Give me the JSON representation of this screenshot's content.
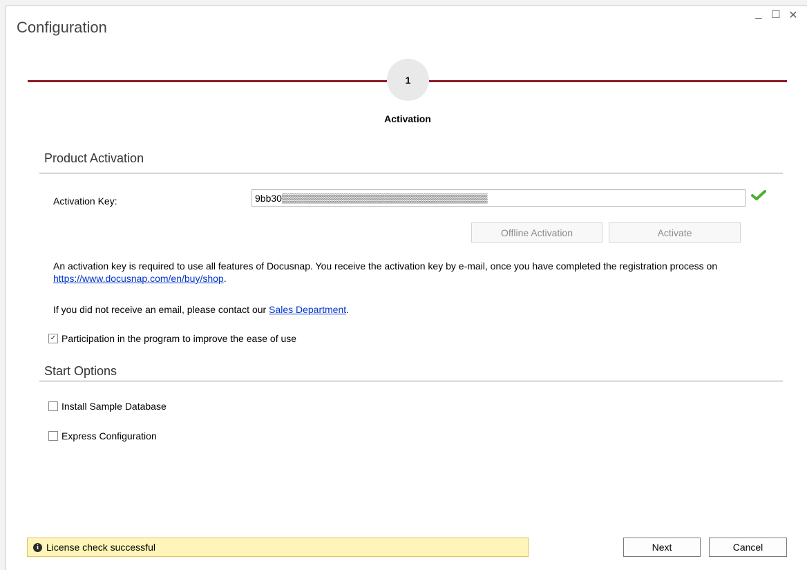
{
  "window": {
    "title": "Configuration",
    "controls": {
      "minimize": "_",
      "maximize": "☐",
      "close": "✕"
    }
  },
  "steps": [
    {
      "number": "1",
      "label": "Activation"
    }
  ],
  "product_activation": {
    "section_title": "Product Activation",
    "key_label": "Activation Key:",
    "key_value": "9bb30▒▒▒▒▒▒▒▒▒▒▒▒▒▒▒▒▒▒▒▒▒▒▒▒▒▒▒▒▒▒",
    "offline_button": "Offline Activation",
    "activate_button": "Activate",
    "info_text_1": "An activation key is required to use all features of Docusnap. You receive the activation key by e-mail, once you have completed the registration process on",
    "info_link": "https://www.docusnap.com/en/buy/shop",
    "info_suffix": ".",
    "info_text_2": "If you did not receive an email, please contact our",
    "sales_link": "Sales Department",
    "participation_label": "Participation in the program to improve the ease of use",
    "participation_checked": true
  },
  "start_options": {
    "section_title": "Start Options",
    "install_sample_label": "Install Sample Database",
    "express_config_label": "Express Configuration"
  },
  "status": {
    "text": "License check successful"
  },
  "buttons": {
    "next": "Next",
    "cancel": "Cancel"
  },
  "colors": {
    "step_line": "#8b1a24",
    "status_bg": "#fff5b8",
    "link": "#0033cc",
    "check": "#4caf2f"
  },
  "icons": {
    "key_valid": "check-icon",
    "status": "info-icon"
  }
}
